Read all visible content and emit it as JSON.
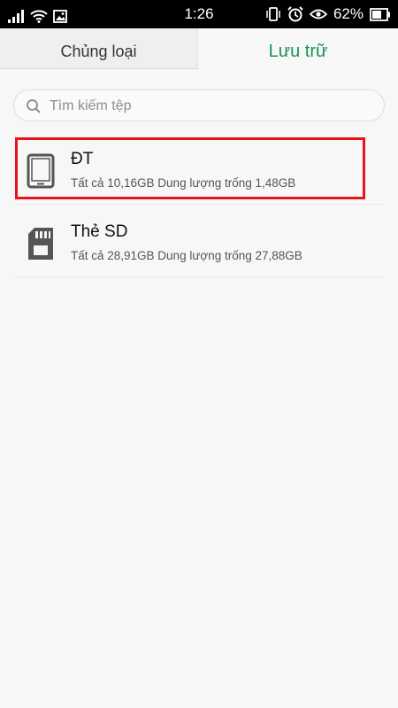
{
  "status_bar": {
    "time": "1:26",
    "battery_percent": "62%",
    "icons": [
      "signal-icon",
      "wifi-icon",
      "image-notification-icon",
      "vibrate-icon",
      "alarm-icon",
      "eye-icon",
      "battery-icon"
    ]
  },
  "tabs": [
    {
      "label": "Chủng loại",
      "active": false
    },
    {
      "label": "Lưu trữ",
      "active": true
    }
  ],
  "search": {
    "placeholder": "Tìm kiếm tệp"
  },
  "storage": [
    {
      "title": "ĐT",
      "subtitle": "Tất cả 10,16GB Dung lượng trống 1,48GB",
      "icon": "phone-icon",
      "highlighted": true
    },
    {
      "title": "Thẻ SD",
      "subtitle": "Tất cả 28,91GB Dung lượng trống 27,88GB",
      "icon": "sd-card-icon",
      "highlighted": false
    }
  ],
  "colors": {
    "accent": "#1a9156",
    "highlight": "#e8141c",
    "background": "#f7f7f7"
  }
}
